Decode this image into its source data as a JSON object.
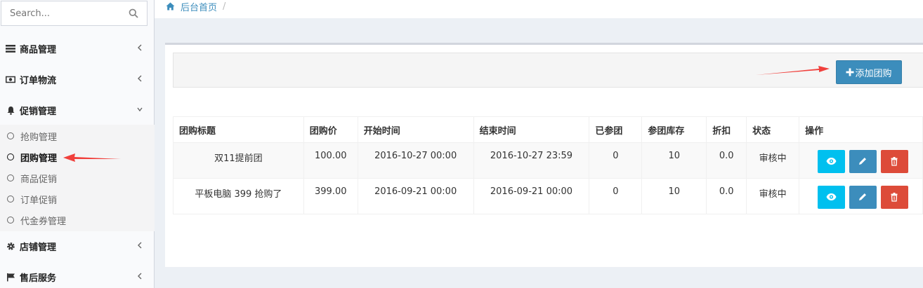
{
  "search": {
    "placeholder": "Search..."
  },
  "sidebar": {
    "menus": [
      {
        "label": "商品管理",
        "icon": "list-icon"
      },
      {
        "label": "订单物流",
        "icon": "money-icon"
      },
      {
        "label": "促销管理",
        "icon": "bell-icon"
      },
      {
        "label": "店铺管理",
        "icon": "gear-icon"
      },
      {
        "label": "售后服务",
        "icon": "flag-icon"
      }
    ],
    "promo_sub": [
      {
        "label": "抢购管理"
      },
      {
        "label": "团购管理",
        "active": true
      },
      {
        "label": "商品促销"
      },
      {
        "label": "订单促销"
      },
      {
        "label": "代金券管理"
      }
    ]
  },
  "breadcrumb": {
    "home": "后台首页",
    "separator": "/"
  },
  "toolbar": {
    "add_label": "添加团购"
  },
  "table": {
    "headers": [
      "团购标题",
      "团购价",
      "开始时间",
      "结束时间",
      "已参团",
      "参团库存",
      "折扣",
      "状态",
      "操作"
    ],
    "rows": [
      [
        "双11提前团",
        "100.00",
        "2016-10-27 00:00",
        "2016-10-27 23:59",
        "0",
        "10",
        "0.0",
        "审核中"
      ],
      [
        "平板电脑 399 抢购了",
        "399.00",
        "2016-09-21 00:00",
        "2016-09-21 00:00",
        "0",
        "10",
        "0.0",
        "审核中"
      ]
    ]
  },
  "colors": {
    "primary": "#3c8dbc",
    "info": "#00c0ef",
    "danger": "#dd4b39",
    "annotation_arrow": "#f0403c"
  }
}
